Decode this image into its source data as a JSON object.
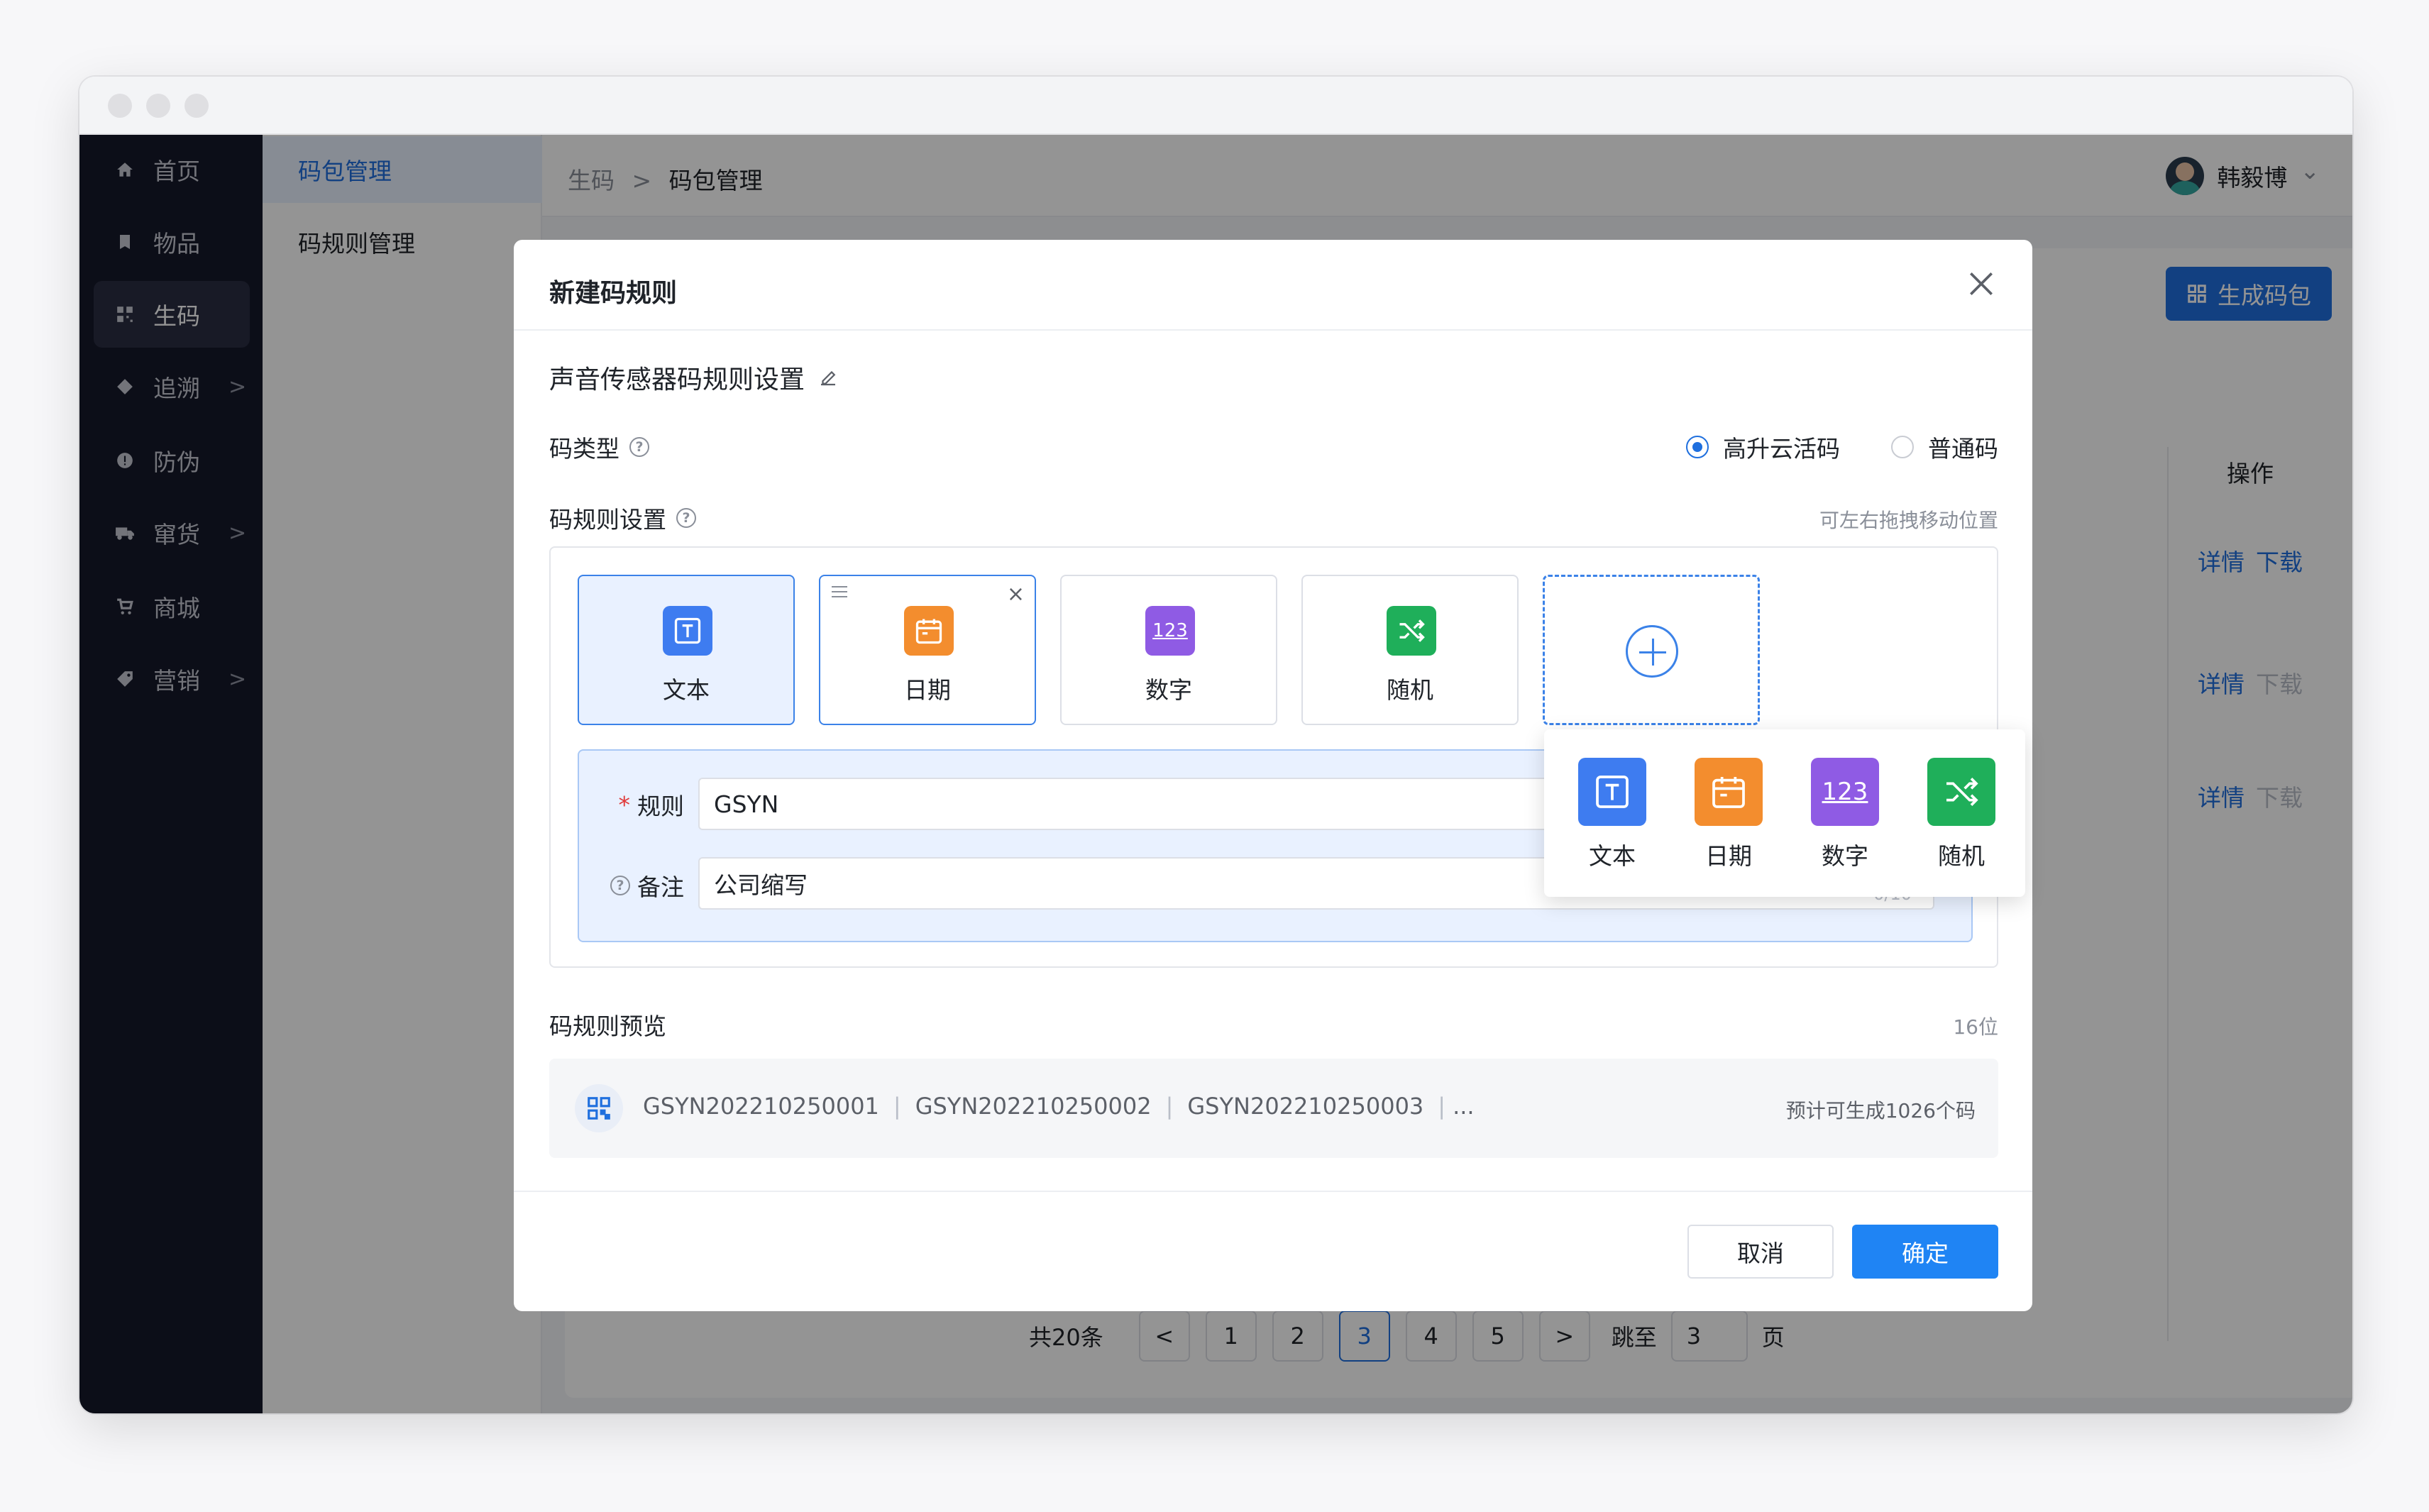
{
  "sidebar": {
    "items": [
      {
        "label": "首页",
        "icon": "home-icon"
      },
      {
        "label": "物品",
        "icon": "book-icon"
      },
      {
        "label": "生码",
        "icon": "qrcode-icon",
        "active": true
      },
      {
        "label": "追溯",
        "icon": "diamond-icon",
        "chevron": ">"
      },
      {
        "label": "防伪",
        "icon": "shield-icon"
      },
      {
        "label": "窜货",
        "icon": "truck-icon",
        "chevron": ">"
      },
      {
        "label": "商城",
        "icon": "cart-icon"
      },
      {
        "label": "营销",
        "icon": "tag-icon",
        "chevron": ">"
      }
    ]
  },
  "submenu": {
    "items": [
      {
        "label": "码包管理",
        "active": true
      },
      {
        "label": "码规则管理"
      }
    ]
  },
  "breadcrumb": {
    "parent": "生码",
    "separator": ">",
    "current": "码包管理"
  },
  "user": {
    "name": "韩毅博",
    "chevron": "⌄"
  },
  "background": {
    "generate_button": "生成码包",
    "operation_header": "操作",
    "rows": [
      {
        "detail": "详情",
        "download": "下载",
        "download_enabled": true
      },
      {
        "detail": "详情",
        "download": "下载",
        "download_enabled": false
      },
      {
        "detail": "详情",
        "download": "下载",
        "download_enabled": false
      }
    ],
    "pagination": {
      "total": "共20条",
      "prev": "<",
      "pages": [
        "1",
        "2",
        "3",
        "4",
        "5"
      ],
      "current": "3",
      "next": ">",
      "jump_label": "跳至",
      "jump_value": "3",
      "page_suffix": "页"
    }
  },
  "modal": {
    "title": "新建码规则",
    "rule_title": "声音传感器码规则设置",
    "code_type": {
      "label": "码类型",
      "options": [
        {
          "label": "高升云活码",
          "selected": true
        },
        {
          "label": "普通码",
          "selected": false
        }
      ]
    },
    "rule_settings": {
      "label": "码规则设置",
      "hint": "可左右拖拽移动位置",
      "tiles": [
        {
          "label": "文本",
          "icon": "text-icon",
          "color": "#3e7cf0"
        },
        {
          "label": "日期",
          "icon": "calendar-icon",
          "color": "#f38d2e"
        },
        {
          "label": "数字",
          "icon": "number-icon",
          "color": "#8f5be4",
          "glyph": "123"
        },
        {
          "label": "随机",
          "icon": "shuffle-icon",
          "color": "#1faf5a"
        }
      ],
      "close_glyph": "×",
      "fields": {
        "rule_label": "规则",
        "rule_required": "*",
        "rule_value": "GSYN",
        "note_label": "备注",
        "note_value": "公司缩写",
        "note_counter": "0/10"
      }
    },
    "popover": {
      "items": [
        {
          "label": "文本",
          "icon": "text-icon"
        },
        {
          "label": "日期",
          "icon": "calendar-icon"
        },
        {
          "label": "数字",
          "icon": "number-icon",
          "glyph": "123"
        },
        {
          "label": "随机",
          "icon": "shuffle-icon"
        }
      ]
    },
    "preview": {
      "label": "码规则预览",
      "length": "16位",
      "codes": [
        "GSYN202210250001",
        "GSYN202210250002",
        "GSYN202210250003"
      ],
      "ellipsis": "...",
      "separator": "|",
      "estimate": "预计可生成1026个码"
    },
    "cancel_label": "取消",
    "ok_label": "确定"
  },
  "colors": {
    "primary": "#1f6fde",
    "sidebar": "#16192a",
    "text_tile": "#3e7cf0",
    "date_tile": "#f38d2e",
    "number_tile": "#8f5be4",
    "random_tile": "#1faf5a"
  }
}
